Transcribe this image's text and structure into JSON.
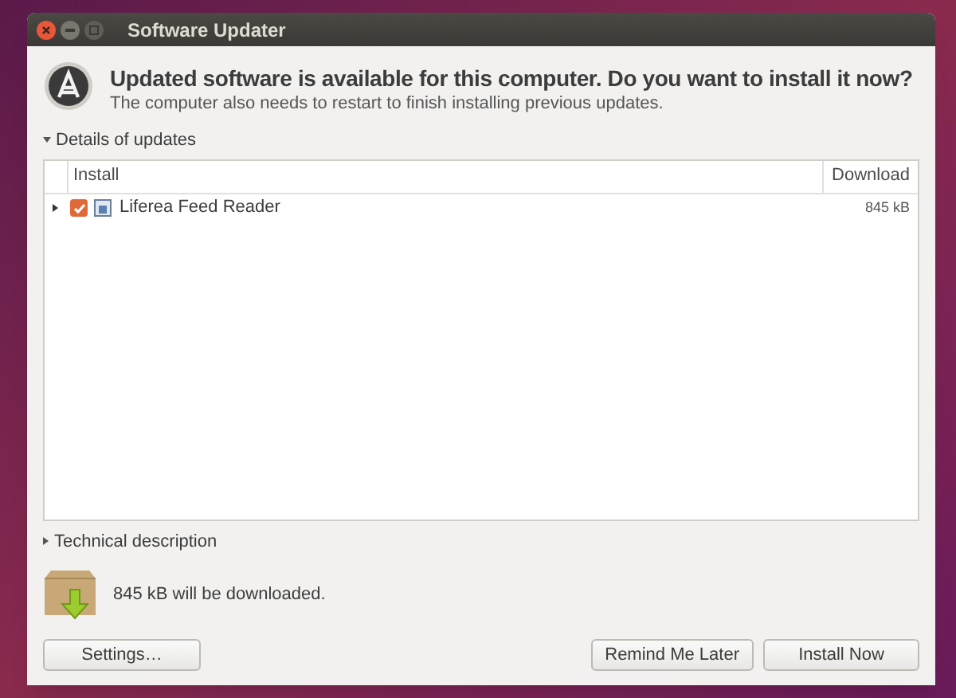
{
  "window": {
    "title": "Software Updater"
  },
  "header": {
    "heading": "Updated software is available for this computer. Do you want to install it now?",
    "subheading": "The computer also needs to restart to finish installing previous updates."
  },
  "details": {
    "label": "Details of updates",
    "expanded": true
  },
  "table": {
    "columns": [
      "Install",
      "Download"
    ],
    "rows": [
      {
        "name": "Liferea Feed Reader",
        "size": "845 kB",
        "checked": true,
        "expanded": false
      }
    ]
  },
  "technical": {
    "label": "Technical description",
    "expanded": false
  },
  "summary": "845 kB will be downloaded.",
  "buttons": [
    {
      "label": "Settings…",
      "kind": "extra"
    },
    {
      "label": "Remind Me Later",
      "kind": "action"
    },
    {
      "label": "Install Now",
      "kind": "action"
    }
  ]
}
